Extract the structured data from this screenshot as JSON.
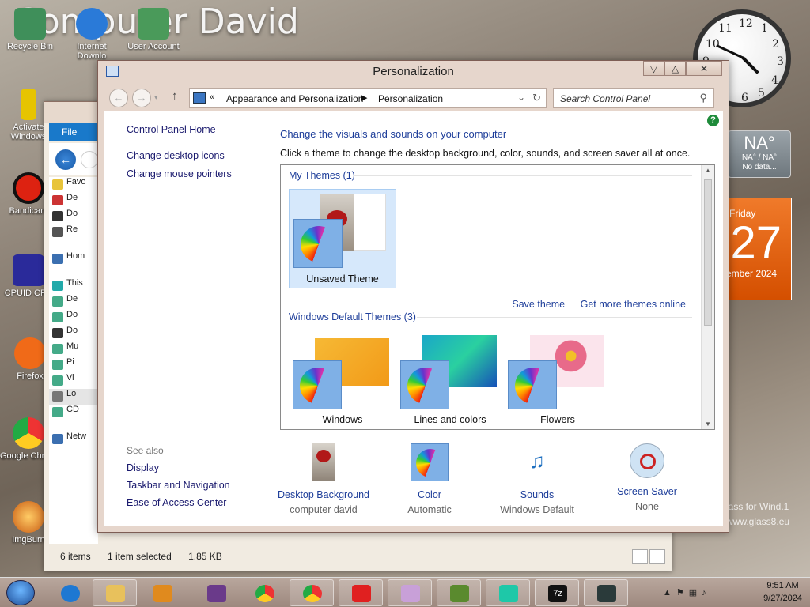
{
  "wallpaper_text": "Computer David",
  "desktop_icons": [
    {
      "label": "Recycle Bin",
      "color": "#3f8f5a"
    },
    {
      "label": "Internet Downlo",
      "color": "#2a7ad8"
    },
    {
      "label": "User Account",
      "color": "#4a9a5a"
    },
    {
      "label": "Activate Windows",
      "color": "#e6c400"
    },
    {
      "label": "Bandicam",
      "color": "#d21"
    },
    {
      "label": "CPUID CPU",
      "color": "#2a2a9a"
    },
    {
      "label": "Firefox",
      "color": "#f06a18"
    },
    {
      "label": "Google Chrome",
      "color": "#2c9a46"
    },
    {
      "label": "ImgBurn",
      "color": "#c85a12"
    }
  ],
  "gadgets": {
    "clock_numbers": [
      "12",
      "1",
      "2",
      "3",
      "4",
      "5",
      "6",
      "7",
      "8",
      "9",
      "10",
      "11"
    ],
    "weather": {
      "temp": "NA°",
      "range": "NA° / NA°",
      "status": "No data..."
    },
    "calendar": {
      "day_name": "Friday",
      "day_num": "27",
      "month_year": "ember 2024"
    },
    "glass_text": "lass for Wind.1",
    "glass_url": "www.glass8.eu"
  },
  "explorer": {
    "ribbon_tab": "File",
    "nav_items": [
      "Favo",
      "De",
      "Do",
      "Re",
      "Hom",
      "This",
      "De",
      "Do",
      "Do",
      "Mu",
      "Pi",
      "Vi",
      "Lo",
      "CD",
      "Netw"
    ],
    "status": {
      "items": "6 items",
      "selected": "1 item selected",
      "size": "1.85 KB"
    }
  },
  "window": {
    "title": "Personalization",
    "controls": {
      "minimize": "▽",
      "maximize": "△",
      "close": "✕"
    },
    "breadcrumb": [
      "Appearance and Personalization",
      "Personalization"
    ],
    "breadcrumb_lead": "«",
    "search_placeholder": "Search Control Panel",
    "left_nav": [
      "Control Panel Home",
      "Change desktop icons",
      "Change mouse pointers"
    ],
    "see_also": {
      "heading": "See also",
      "links": [
        "Display",
        "Taskbar and Navigation",
        "Ease of Access Center"
      ]
    },
    "heading": "Change the visuals and sounds on your computer",
    "subheading": "Click a theme to change the desktop background, color, sounds, and screen saver all at once.",
    "my_themes_label": "My Themes (1)",
    "my_themes": [
      {
        "name": "Unsaved Theme",
        "selected": true
      }
    ],
    "save_theme": "Save theme",
    "get_more_themes": "Get more themes online",
    "default_themes_label": "Windows Default Themes (3)",
    "default_themes": [
      {
        "name": "Windows",
        "accent": "#f29a18"
      },
      {
        "name": "Lines and colors",
        "accent": "#1aa7c8"
      },
      {
        "name": "Flowers",
        "accent": "#e86a8a"
      }
    ],
    "bottom": [
      {
        "label": "Desktop Background",
        "value": "computer david"
      },
      {
        "label": "Color",
        "value": "Automatic"
      },
      {
        "label": "Sounds",
        "value": "Windows Default"
      },
      {
        "label": "Screen Saver",
        "value": "None"
      }
    ]
  },
  "taskbar": {
    "apps": [
      {
        "name": "internet-explorer",
        "color": "#1e78d2"
      },
      {
        "name": "file-explorer",
        "color": "#e8c15c"
      },
      {
        "name": "media-player",
        "color": "#e08a1e"
      },
      {
        "name": "winrar",
        "color": "#6a3a8a"
      },
      {
        "name": "chrome",
        "color": "#2c9a46"
      },
      {
        "name": "chrome-alt",
        "color": "#e8a81c"
      },
      {
        "name": "roblox",
        "color": "#e02020"
      },
      {
        "name": "personalization",
        "color": "#c8a0d8"
      },
      {
        "name": "minecraft",
        "color": "#5a8a2e"
      },
      {
        "name": "monitor-app",
        "color": "#1ec8a8"
      },
      {
        "name": "7zip",
        "color": "#111111"
      },
      {
        "name": "terminal-app",
        "color": "#2a3a3a"
      }
    ],
    "time": "9:51 AM",
    "date": "9/27/2024"
  }
}
